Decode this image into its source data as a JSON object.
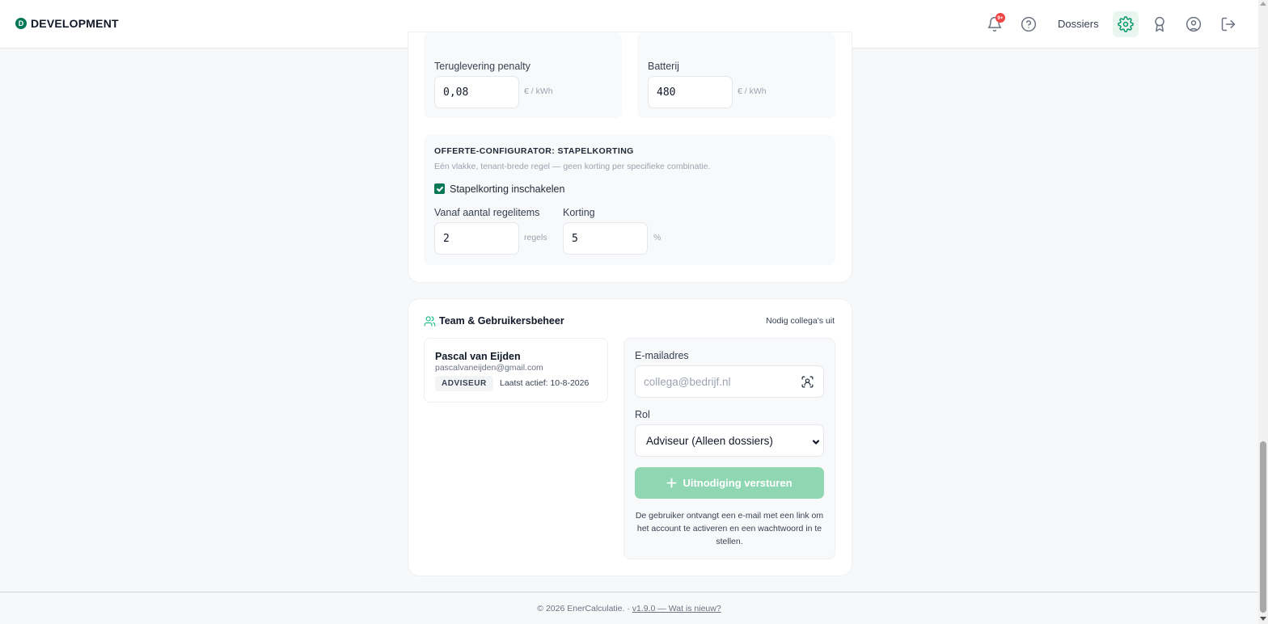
{
  "header": {
    "brand_mark": "D",
    "brand": "DEVELOPMENT",
    "notification_count": "9+",
    "dossiers_label": "Dossiers",
    "icons": [
      "bell-icon",
      "help-icon",
      "gear-icon",
      "award-icon",
      "user-circle-icon",
      "logout-icon"
    ]
  },
  "tariffs": {
    "penalty": {
      "label": "Teruglevering penalty",
      "value": "0,08",
      "unit": "€ / kWh"
    },
    "battery": {
      "label": "Batterij",
      "value": "480",
      "unit": "€ / kWh"
    }
  },
  "stack_discount": {
    "title": "OFFERTE-CONFIGURATOR: STAPELKORTING",
    "description": "Eén vlakke, tenant-brede regel — geen korting per specifieke combinatie.",
    "enable_label": "Stapelkorting inschakelen",
    "enabled": true,
    "from_items": {
      "label": "Vanaf aantal regelitems",
      "value": "2",
      "unit": "regels"
    },
    "discount": {
      "label": "Korting",
      "value": "5",
      "unit": "%"
    }
  },
  "team": {
    "title": "Team & Gebruikersbeheer",
    "invite_link": "Nodig collega's uit",
    "user": {
      "name": "Pascal van Eijden",
      "email": "pascalvaneijden@gmail.com",
      "role": "ADVISEUR",
      "last_active": "Laatst actief: 10-8-2026"
    },
    "invite": {
      "email_label": "E-mailadres",
      "email_placeholder": "collega@bedrijf.nl",
      "role_label": "Rol",
      "role_value": "Adviseur (Alleen dossiers)",
      "button": "Uitnodiging versturen",
      "note": "De gebruiker ontvangt een e-mail met een link om het account te activeren en een wachtwoord in te stellen."
    }
  },
  "footer": {
    "copyright": "© 2026 EnerCalculatie. · ",
    "version_link": "v1.9.0 — Wat is nieuw?"
  },
  "colors": {
    "accent": "#047857",
    "accent_light": "#8fd6b2",
    "badge_red": "#ef4444"
  }
}
